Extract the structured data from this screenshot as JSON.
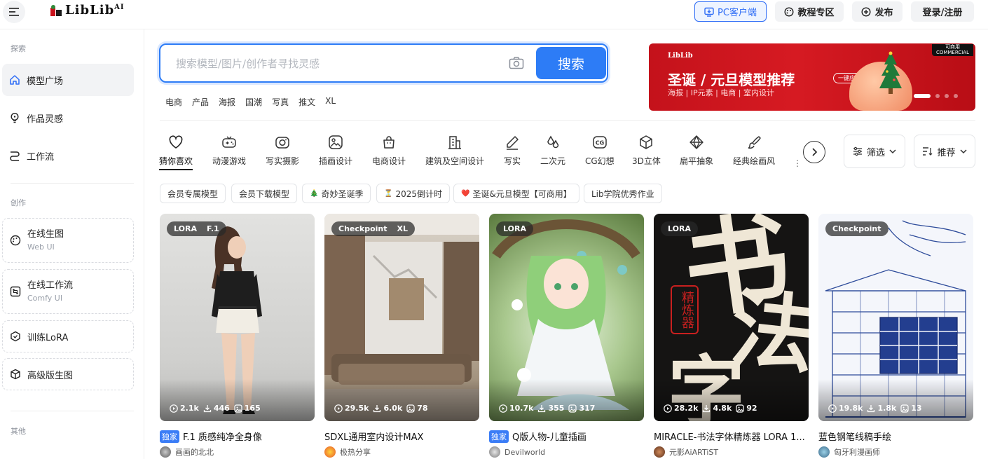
{
  "header": {
    "logo_text": "LibLib",
    "logo_sup": "AI",
    "pc_client": "PC客户端",
    "tutorial": "教程专区",
    "publish": "发布",
    "login": "登录/注册"
  },
  "sidebar": {
    "groups": [
      "探索",
      "创作",
      "其他"
    ],
    "items": [
      {
        "label": "模型广场"
      },
      {
        "label": "作品灵感"
      },
      {
        "label": "工作流"
      },
      {
        "label": "在线生图",
        "sub": "Web UI"
      },
      {
        "label": "在线工作流",
        "sub": "Comfy UI"
      },
      {
        "label": "训练LoRA"
      },
      {
        "label": "高级版生图"
      }
    ]
  },
  "search": {
    "placeholder": "搜索模型/图片/创作者寻找灵感",
    "button": "搜索",
    "hot_tags": [
      "电商",
      "产品",
      "海报",
      "国潮",
      "写真",
      "推文",
      "XL"
    ]
  },
  "banner": {
    "logo": "LibLib",
    "title": "圣诞 / 元旦模型推荐",
    "chip": "一键应用",
    "subtitle": "海报 | IP元素 | 电商 | 室内设计",
    "badge_line1": "可商用",
    "badge_line2": "COMMERCIAL"
  },
  "categories": [
    {
      "label": "猜你喜欢",
      "icon": "heart-icon"
    },
    {
      "label": "动漫游戏",
      "icon": "gamepad-icon"
    },
    {
      "label": "写实摄影",
      "icon": "camera-icon"
    },
    {
      "label": "插画设计",
      "icon": "image-icon"
    },
    {
      "label": "电商设计",
      "icon": "bag-icon"
    },
    {
      "label": "建筑及空间设计",
      "icon": "building-icon"
    },
    {
      "label": "写实",
      "icon": "pen-icon"
    },
    {
      "label": "二次元",
      "icon": "drops-icon"
    },
    {
      "label": "CG幻想",
      "icon": "cg-icon"
    },
    {
      "label": "3D立体",
      "icon": "cube-icon"
    },
    {
      "label": "扁平抽象",
      "icon": "diamond-icon"
    },
    {
      "label": "经典绘画风",
      "icon": "brush-icon"
    }
  ],
  "filters": {
    "filter": "筛选",
    "sort": "推荐"
  },
  "quick_tags": [
    {
      "label": "会员专属模型",
      "emoji": ""
    },
    {
      "label": "会员下载模型",
      "emoji": ""
    },
    {
      "label": "奇妙圣诞季",
      "emoji": "🎄"
    },
    {
      "label": "2025倒计时",
      "emoji": "⏳"
    },
    {
      "label": "圣诞&元旦模型【可商用】",
      "emoji": "❤️"
    },
    {
      "label": "Lib学院优秀作业",
      "emoji": ""
    }
  ],
  "cards": [
    {
      "badges": [
        "LORA",
        "F.1"
      ],
      "views": "2.1k",
      "downloads": "446",
      "images": "165",
      "exclusive": "独家",
      "title": "F.1 质感纯净全身像",
      "author": "画画的北北"
    },
    {
      "badges": [
        "Checkpoint",
        "XL"
      ],
      "views": "29.5k",
      "downloads": "6.0k",
      "images": "78",
      "exclusive": "",
      "title": "SDXL通用室内设计MAX",
      "author": "极热分享"
    },
    {
      "badges": [
        "LORA"
      ],
      "views": "10.7k",
      "downloads": "355",
      "images": "317",
      "exclusive": "独家",
      "title": "Q版人物-儿童插画",
      "author": "Devilworld"
    },
    {
      "badges": [
        "LORA"
      ],
      "views": "28.2k",
      "downloads": "4.8k",
      "images": "92",
      "exclusive": "",
      "title": "MIRACLE-书法字体精炼器 LORA 1...",
      "author": "元影AiARTiST"
    },
    {
      "badges": [
        "Checkpoint"
      ],
      "views": "19.8k",
      "downloads": "1.8k",
      "images": "13",
      "exclusive": "",
      "title": "蓝色钢笔线稿手绘",
      "author": "匈牙利漫画师"
    }
  ],
  "calligraphy": {
    "big1": "书",
    "big2": "法",
    "big3": "字",
    "seal": "精炼器"
  },
  "colors": {
    "accent": "#2d7cf6",
    "banner_red": "#d61a22",
    "exclusive": "#3b7df6"
  }
}
